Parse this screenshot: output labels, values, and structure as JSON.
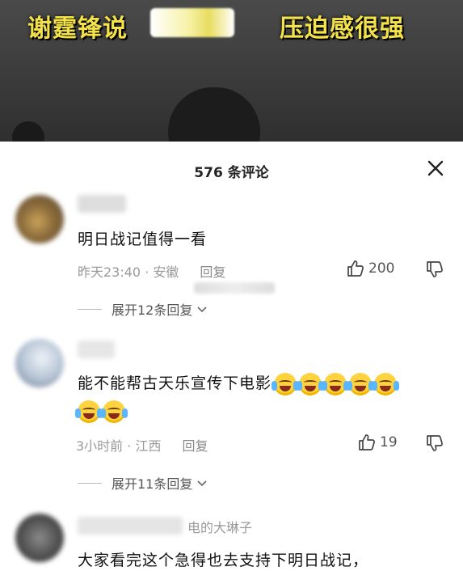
{
  "video": {
    "caption_left": "谢霆锋说",
    "caption_right": "压迫感很强"
  },
  "comments_panel": {
    "title": "576 条评论",
    "close_icon": "close-icon"
  },
  "comments": [
    {
      "text": "明日战记值得一看",
      "time_location": "昨天23:40 · 安徽",
      "reply_label": "回复",
      "likes": "200",
      "expand_label": "展开12条回复"
    },
    {
      "text": "能不能帮古天乐宣传下电影",
      "emoji_name": "laughing-crying-emoji",
      "time_location": "3小时前 · 江西",
      "reply_label": "回复",
      "likes": "19",
      "expand_label": "展开11条回复"
    },
    {
      "username_visible_part": "电的大琳子",
      "text": "大家看完这个急得也去支持下明日战记，"
    }
  ]
}
